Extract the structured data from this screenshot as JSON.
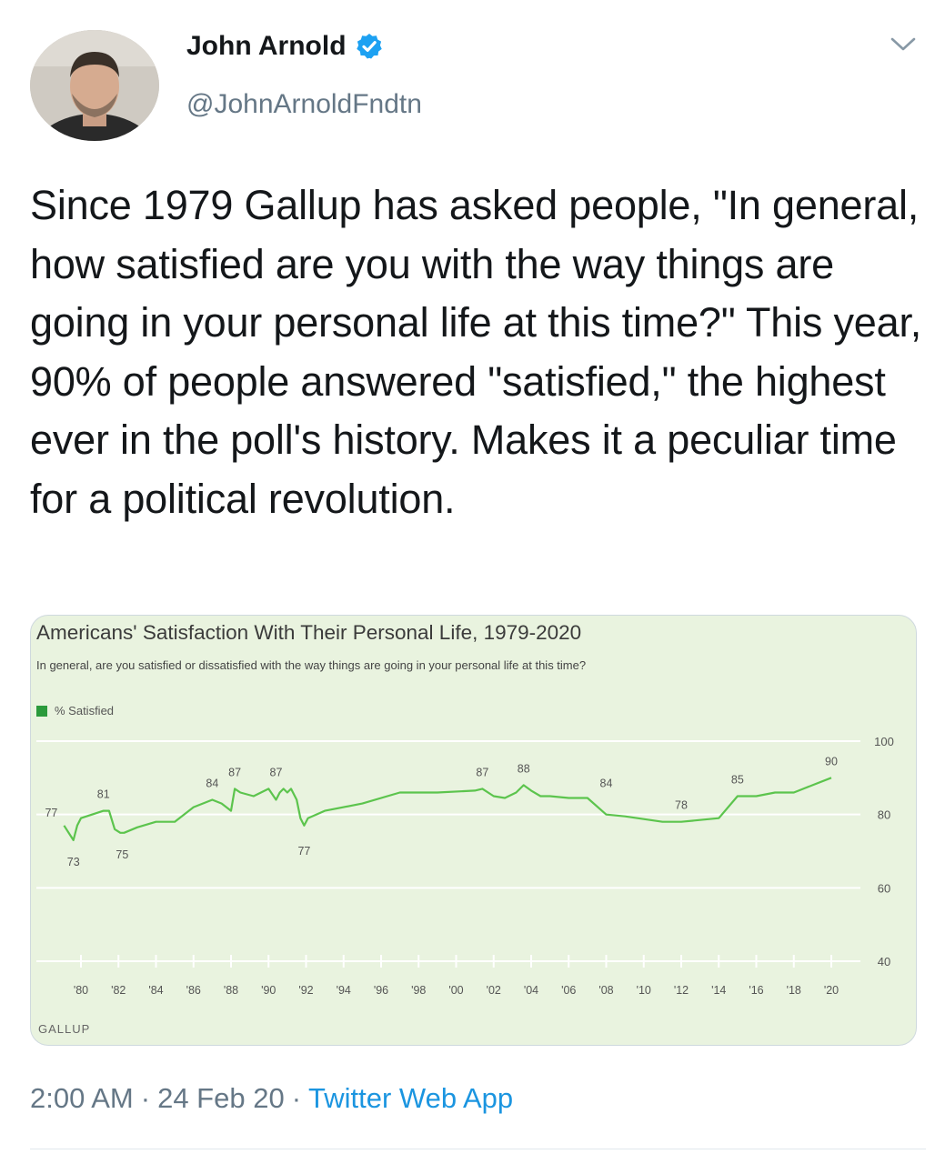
{
  "author": {
    "name": "John Arnold",
    "handle": "@JohnArnoldFndtn",
    "verified_icon": "verified-badge-icon",
    "verified_color": "#1da1f2"
  },
  "tweet": {
    "text": "Since 1979 Gallup has asked people, \"In general, how satisfied are you with the way things are going in your personal life at this time?\" This year, 90% of people answered \"satisfied,\" the highest ever in the poll's history. Makes it a peculiar time for a political revolution.",
    "time": "2:00 AM",
    "date": "24 Feb 20",
    "source": "Twitter Web App",
    "separator": "·"
  },
  "chart": {
    "title": "Americans' Satisfaction With Their Personal Life, 1979-2020",
    "subtitle": "In general, are you satisfied or dissatisfied with the way things are going in your personal life at this time?",
    "legend": "% Satisfied",
    "footer": "GALLUP"
  },
  "chart_data": {
    "type": "line",
    "title": "Americans' Satisfaction With Their Personal Life, 1979-2020",
    "ylim": [
      40,
      100
    ],
    "yticks": [
      40,
      60,
      80,
      100
    ],
    "xticks": [
      "'80",
      "'82",
      "'84",
      "'86",
      "'88",
      "'90",
      "'92",
      "'94",
      "'96",
      "'98",
      "'00",
      "'02",
      "'04",
      "'06",
      "'08",
      "'10",
      "'12",
      "'14",
      "'16",
      "'18",
      "'20"
    ],
    "xtick_years": [
      1980,
      1982,
      1984,
      1986,
      1988,
      1990,
      1992,
      1994,
      1996,
      1998,
      2000,
      2002,
      2004,
      2006,
      2008,
      2010,
      2012,
      2014,
      2016,
      2018,
      2020
    ],
    "grid": true,
    "legend_position": "top-left",
    "color": "#5cc44d",
    "series": [
      {
        "name": "% Satisfied",
        "x": [
          1979.1,
          1979.6,
          1979.8,
          1980.0,
          1981.2,
          1981.5,
          1981.8,
          1982.1,
          1982.3,
          1983.0,
          1984.0,
          1985.0,
          1986.0,
          1987.0,
          1987.5,
          1988.0,
          1988.2,
          1988.5,
          1989.2,
          1990.0,
          1990.4,
          1990.6,
          1990.8,
          1991.0,
          1991.2,
          1991.5,
          1991.7,
          1991.9,
          1992.1,
          1993.0,
          1995.0,
          1997.0,
          1999.0,
          2001.0,
          2001.4,
          2002.0,
          2002.6,
          2003.2,
          2003.6,
          2004.0,
          2004.5,
          2005.0,
          2006.0,
          2007.0,
          2008.0,
          2009.0,
          2011.0,
          2012.0,
          2013.0,
          2014.0,
          2015.0,
          2016.0,
          2017.0,
          2018.0,
          2019.0,
          2020.0
        ],
        "y": [
          77,
          73,
          77,
          79,
          81,
          81,
          76,
          75,
          75,
          76.5,
          78,
          78,
          82,
          84,
          83,
          81,
          87,
          86,
          85,
          87,
          84,
          86,
          87,
          86,
          87,
          84,
          79,
          77,
          79,
          81,
          83,
          86,
          86,
          86.5,
          87,
          85,
          84.5,
          86,
          88,
          86.5,
          85,
          85,
          84.5,
          84.5,
          80,
          79.5,
          78,
          78,
          78.5,
          79,
          85,
          85,
          86,
          86,
          88,
          90
        ]
      }
    ],
    "data_labels": [
      {
        "year": 1979.1,
        "value": 77,
        "text": "77"
      },
      {
        "year": 1979.6,
        "value": 73,
        "text": "73"
      },
      {
        "year": 1981.2,
        "value": 81,
        "text": "81"
      },
      {
        "year": 1982.2,
        "value": 75,
        "text": "75"
      },
      {
        "year": 1987.0,
        "value": 84,
        "text": "84"
      },
      {
        "year": 1988.2,
        "value": 87,
        "text": "87"
      },
      {
        "year": 1990.4,
        "value": 87,
        "text": "87"
      },
      {
        "year": 1991.9,
        "value": 77,
        "text": "77"
      },
      {
        "year": 2001.4,
        "value": 87,
        "text": "87"
      },
      {
        "year": 2003.6,
        "value": 88,
        "text": "88"
      },
      {
        "year": 2008.0,
        "value": 84,
        "text": "84"
      },
      {
        "year": 2012.0,
        "value": 78,
        "text": "78"
      },
      {
        "year": 2015.0,
        "value": 85,
        "text": "85"
      },
      {
        "year": 2020.0,
        "value": 90,
        "text": "90"
      }
    ]
  }
}
